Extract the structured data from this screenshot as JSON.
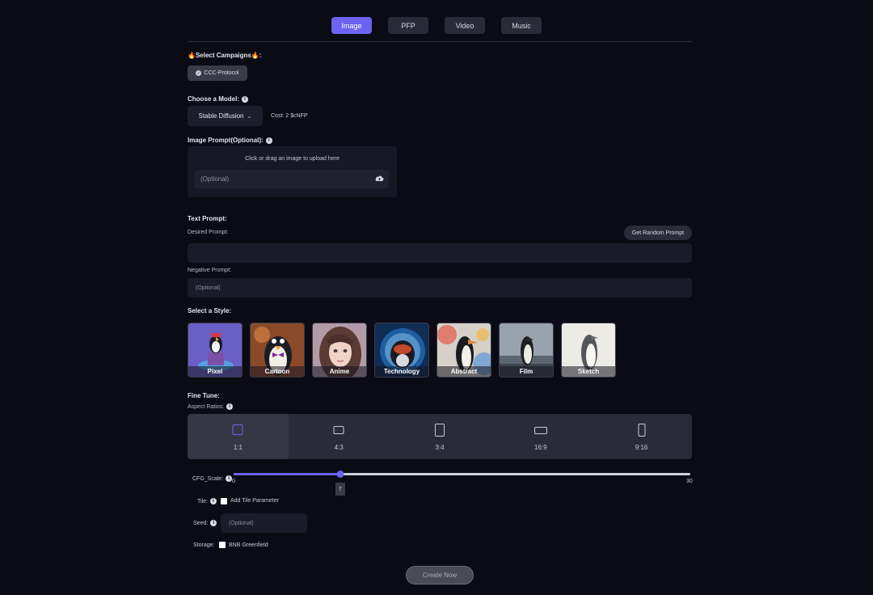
{
  "tabs": [
    {
      "label": "Image",
      "active": true
    },
    {
      "label": "PFP",
      "active": false
    },
    {
      "label": "Video",
      "active": false
    },
    {
      "label": "Music",
      "active": false
    }
  ],
  "campaigns": {
    "label": "🔥Select Campaigns🔥:",
    "selected": "CCC-Protocol"
  },
  "model": {
    "label": "Choose a Model:",
    "selected": "Stable Diffusion",
    "cost": "Cost: 2 $cNFP"
  },
  "image_prompt": {
    "label": "Image Prompt(Optional):",
    "hint": "Click or drag an image to upload here",
    "placeholder": "(Optional)"
  },
  "text_prompt": {
    "label": "Text Prompt:",
    "desired_label": "Desired Prompt:",
    "random_button": "Get Random Prompt",
    "negative_label": "Negative Prompt:",
    "negative_placeholder": "(Optional)"
  },
  "styles": {
    "label": "Select a Style:",
    "items": [
      "Pixel",
      "Cartoon",
      "Anime",
      "Technology",
      "Abstract",
      "Film",
      "Sketch"
    ]
  },
  "fine_tune": {
    "label": "Fine Tune:",
    "aspect_label": "Aspect Ratios:",
    "aspect_ratios": [
      "1:1",
      "4:3",
      "3:4",
      "16:9",
      "9:16"
    ],
    "selected_aspect": "1:1",
    "cfg_label": "CFG_Scale:",
    "cfg_min": "0",
    "cfg_max": "30",
    "cfg_value": "7",
    "tile_label": "Tile:",
    "tile_option": "Add Tile Parameter",
    "seed_label": "Seed:",
    "seed_placeholder": "(Optional)",
    "storage_label": "Storage:",
    "storage_option": "BNB Greenfield"
  },
  "create_button": "Create Now",
  "colors": {
    "accent": "#6c63f0",
    "background": "#0a0b14"
  }
}
